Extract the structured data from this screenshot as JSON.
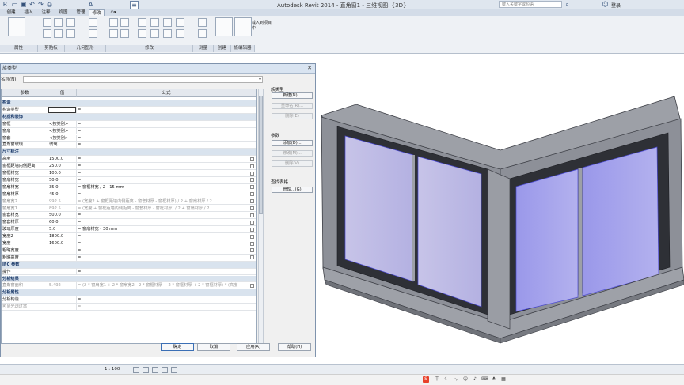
{
  "window": {
    "title": "Autodesk Revit 2014 -",
    "project_name": "直角窗1 - 三维视图: {3D}",
    "search_placeholder": "键入关键字或短语",
    "login": "登录",
    "tabs": [
      "创建",
      "插入",
      "注释",
      "视图",
      "管理",
      "修改"
    ]
  },
  "ribbon": {
    "groups": [
      "属性",
      "剪贴板",
      "几何图形",
      "修改",
      "测量",
      "创建",
      "族编辑器"
    ],
    "load_into_project": "载入到项目中"
  },
  "dialog": {
    "title": "族类型",
    "name_label": "名称(N):",
    "columns": [
      "参数",
      "值",
      "公式"
    ],
    "rows": [
      {
        "type": "group",
        "label": "构造"
      },
      {
        "param": "构造类型",
        "value": "",
        "formula": "=",
        "edit": true
      },
      {
        "type": "group",
        "label": "材质和装饰"
      },
      {
        "param": "窗框",
        "value": "<按类别>",
        "formula": "="
      },
      {
        "param": "窗扇",
        "value": "<按类别>",
        "formula": "="
      },
      {
        "param": "窗套",
        "value": "<按类别>",
        "formula": "="
      },
      {
        "param": "直角窗玻璃",
        "value": "玻璃",
        "formula": "="
      },
      {
        "type": "group",
        "label": "尺寸标注"
      },
      {
        "param": "高度",
        "value": "1500.0",
        "formula": "=",
        "check": true
      },
      {
        "param": "窗框距墙内侧距离",
        "value": "250.0",
        "formula": "=",
        "check": true
      },
      {
        "param": "窗框材宽",
        "value": "100.0",
        "formula": "=",
        "check": true
      },
      {
        "param": "窗扇材宽",
        "value": "50.0",
        "formula": "=",
        "check": true
      },
      {
        "param": "窗扇材宽",
        "value": "35.0",
        "formula": "= 窗框材宽 / 2 - 15 mm",
        "check": true
      },
      {
        "param": "窗扇材厚",
        "value": "45.0",
        "formula": "=",
        "check": true
      },
      {
        "param": "窗扇宽2",
        "value": "992.5",
        "formula": "= (宽度2 + 窗框距墙内侧距离 - 窗套材厚 - 窗框材厚) / 2 + 窗扇材厚 / 2",
        "check": true,
        "dim": true
      },
      {
        "param": "窗扇宽1",
        "value": "892.5",
        "formula": "= (宽度 + 窗框距墙内侧距离 - 窗套材厚 - 窗框材厚) / 2 + 窗扇材厚 / 2",
        "check": true,
        "dim": true
      },
      {
        "param": "窗套材宽",
        "value": "500.0",
        "formula": "=",
        "check": true
      },
      {
        "param": "窗套材厚",
        "value": "60.0",
        "formula": "=",
        "check": true
      },
      {
        "param": "玻璃厚度",
        "value": "5.0",
        "formula": "= 窗扇材宽 - 30 mm",
        "check": true
      },
      {
        "param": "宽度2",
        "value": "1800.0",
        "formula": "=",
        "check": true
      },
      {
        "param": "宽度",
        "value": "1600.0",
        "formula": "=",
        "check": true
      },
      {
        "param": "粗略宽度",
        "value": "",
        "formula": "=",
        "check": true
      },
      {
        "param": "粗略高度",
        "value": "",
        "formula": "=",
        "check": true
      },
      {
        "type": "group",
        "label": "IFC 参数"
      },
      {
        "param": "操作",
        "value": "",
        "formula": "="
      },
      {
        "type": "group",
        "label": "分析结果"
      },
      {
        "param": "直角窗面积",
        "value": "5.492",
        "formula": "= (2 * 窗扇宽1 + 2 * 窗扇宽2 - 2 * 窗框材厚 + 2 * 窗框材厚 + 2 * 窗框材厚) * (高度 -",
        "check": true,
        "dim": true
      },
      {
        "type": "group",
        "label": "分析属性"
      },
      {
        "param": "分析构造",
        "value": "",
        "formula": "="
      },
      {
        "param": "可见光透过率",
        "value": "",
        "formula": "=",
        "dim": true
      }
    ],
    "side": {
      "family_types_label": "族类型",
      "new": "新建(N)...",
      "rename": "重命名(R)...",
      "delete": "删除(E)",
      "params_label": "参数",
      "add": "添加(D)...",
      "modify": "修改(M)...",
      "remove": "删除(V)",
      "lookup_label": "查找表格",
      "manage": "管理...(G)"
    },
    "buttons": {
      "ok": "确定",
      "cancel": "取消",
      "apply": "应用(A)",
      "help": "帮助(H)"
    }
  },
  "statusbar": {
    "scale": "1 : 100"
  },
  "icons": [
    "close-icon",
    "search-icon",
    "dropdown-arrow-icon",
    "checkbox-icon"
  ],
  "colors": {
    "accent": "#2b579a",
    "glass": "#a8a6e6",
    "frame": "#8c8f96",
    "ime": "#e8412a"
  }
}
